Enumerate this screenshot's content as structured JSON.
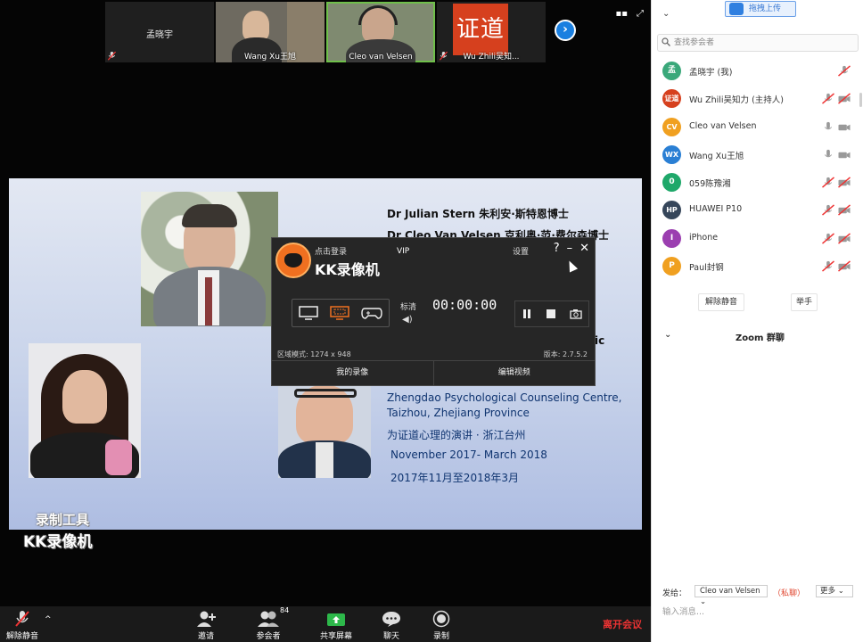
{
  "thumbs": [
    {
      "name": "孟晓宇"
    },
    {
      "name": "Wang Xu王旭"
    },
    {
      "name": "Cleo van Velsen"
    },
    {
      "name": "Wu Zhili吴知...",
      "logo_text": "证道"
    }
  ],
  "slide": {
    "line1": "Dr Julian Stern 朱利安·斯特恩博士",
    "line2": "Dr Cleo Van Velsen 克利奥·范·费尔森博士",
    "line_partial": "ic",
    "line3": "Zhengdao Psychological Counseling Centre,",
    "line4": "Taizhou, Zhejiang Province",
    "line5": "为证道心理的演讲 · 浙江台州",
    "line6": "November 2017- March 2018",
    "line7": "2017年11月至2018年3月"
  },
  "watermark": {
    "line1": "录制工具",
    "line2": "KK录像机"
  },
  "kk": {
    "login": "点击登录",
    "title": "KK录像机",
    "vip": "VIP",
    "settings": "设置",
    "quality": "标清",
    "timer": "00:00:00",
    "region": "区域模式: 1274 x 948",
    "version": "版本: 2.7.5.2",
    "tab_recordings": "我的录像",
    "tab_edit": "编辑视频"
  },
  "toolbar": {
    "unmute": "解除静音",
    "invite": "邀请",
    "participants": "参会者",
    "participants_count": "84",
    "share": "共享屏幕",
    "chat": "聊天",
    "record": "录制",
    "leave": "离开会议"
  },
  "panel": {
    "upload": "拖拽上传",
    "search_placeholder": "查找参会者",
    "participants": [
      {
        "initials": "孟",
        "name": "孟晓宇 (我)",
        "color": "#3aa87a",
        "mic": "muted",
        "cam": "none"
      },
      {
        "initials": "证道",
        "name": "Wu Zhili吴知力 (主持人)",
        "color": "#d6401e",
        "mic": "muted",
        "cam": "off"
      },
      {
        "initials": "CV",
        "name": "Cleo van Velsen",
        "color": "#f0a020",
        "mic": "on",
        "cam": "on"
      },
      {
        "initials": "WX",
        "name": "Wang Xu王旭",
        "color": "#2a7fd4",
        "mic": "on",
        "cam": "on"
      },
      {
        "initials": "0",
        "name": "059陈豫湘",
        "color": "#1fa86a",
        "mic": "muted",
        "cam": "off"
      },
      {
        "initials": "HP",
        "name": "HUAWEI P10",
        "color": "#36465a",
        "mic": "muted",
        "cam": "off"
      },
      {
        "initials": "I",
        "name": "iPhone",
        "color": "#9b3fb0",
        "mic": "muted",
        "cam": "off"
      },
      {
        "initials": "P",
        "name": "Paul封钢",
        "color": "#f0a020",
        "mic": "muted",
        "cam": "off"
      }
    ],
    "unmute_all": "解除静音",
    "raise_hand": "举手",
    "chat_title": "Zoom 群聊",
    "send_to_label": "发给：",
    "send_to": "Cleo van Velsen",
    "private": "（私聊）",
    "more": "更多",
    "input_placeholder": "输入消息..."
  }
}
